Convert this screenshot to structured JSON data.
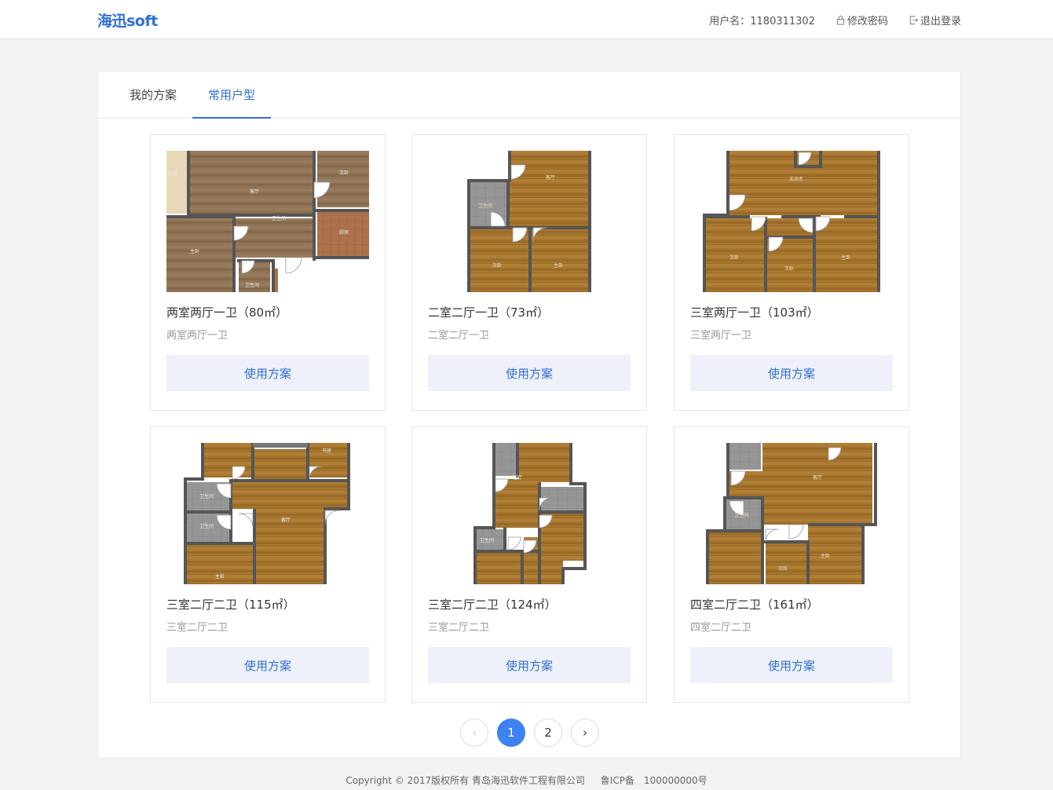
{
  "header": {
    "logo": "海迅soft",
    "username_label": "用户名：1180311302",
    "change_password": "修改密码",
    "logout": "退出登录"
  },
  "tabs": [
    {
      "label": "我的方案",
      "active": false
    },
    {
      "label": "常用户型",
      "active": true
    }
  ],
  "cards": [
    {
      "title": "两室两厅一卫（80㎡）",
      "subtitle": "两室两厅一卫",
      "button": "使用方案",
      "rooms": [
        "阳台",
        "客厅",
        "次卧",
        "主卧",
        "厨房",
        "卫生间",
        "卫生间"
      ]
    },
    {
      "title": "二室二厅一卫（73㎡）",
      "subtitle": "二室二厅一卫",
      "button": "使用方案",
      "rooms": [
        "客厅",
        "卫生间",
        "次卧",
        "主卧"
      ]
    },
    {
      "title": "三室两厅一卫（103㎡）",
      "subtitle": "三室两厅一卫",
      "button": "使用方案",
      "rooms": [
        "未命名",
        "次卧",
        "次卧",
        "主卧"
      ]
    },
    {
      "title": "三室二厅二卫（115㎡）",
      "subtitle": "三室二厅二卫",
      "button": "使用方案",
      "rooms": [
        "卫生间",
        "卫生间",
        "客厅",
        "主卧",
        "书房"
      ]
    },
    {
      "title": "三室二厅二卫（124㎡）",
      "subtitle": "三室二厅二卫",
      "button": "使用方案",
      "rooms": [
        "客厅",
        "卫生间"
      ]
    },
    {
      "title": "四室二厅二卫（161㎡）",
      "subtitle": "四室二厅二卫",
      "button": "使用方案",
      "rooms": [
        "客厅",
        "卫生间",
        "主卧",
        "次卧"
      ]
    }
  ],
  "pagination": {
    "prev": "‹",
    "pages": [
      "1",
      "2"
    ],
    "current": "1",
    "next": "›"
  },
  "footer": {
    "copyright": "Copyright © 2017版权所有 青岛海迅软件工程有限公司",
    "icp": "鲁ICP备　100000000号"
  },
  "colors": {
    "accent": "#2f6fd6",
    "active_page": "#3d82f0",
    "button_bg": "#eef1fa",
    "wood_floor": "#a2742d",
    "tile_floor": "#8b8b8b",
    "wall": "#555555"
  }
}
